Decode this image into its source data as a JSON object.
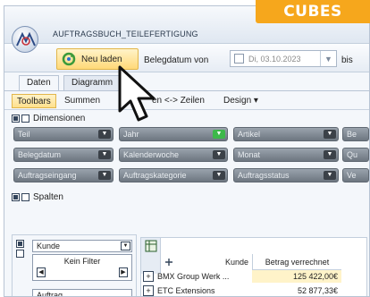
{
  "brand": {
    "label": "CUBES",
    "color": "#f6a71c"
  },
  "window": {
    "title": "AUFTRAGSBUCH_TEILEFERTIGUNG"
  },
  "toolbar": {
    "reload_label": "Neu laden",
    "date_label": "Belegdatum von",
    "date_value": "Di, 03.10.2023",
    "to_label": "bis"
  },
  "tabs": [
    "Daten",
    "Diagramm"
  ],
  "ribbon_tabs": [
    "Toolbars",
    "Summen",
    "Spalten <-> Zeilen",
    "Design ▾"
  ],
  "ribbon_tab_visible": [
    "Toolbars",
    "Summen",
    "en <-> Zeilen",
    "Design ▾"
  ],
  "sections": {
    "dimensions": "Dimensionen",
    "columns": "Spalten"
  },
  "dimensions": {
    "row1": [
      "Teil",
      "Jahr",
      "Artikel",
      "Be"
    ],
    "row2": [
      "Belegdatum",
      "Kalenderwoche",
      "Monat",
      "Qu"
    ],
    "row3": [
      "Auftragseingang",
      "Auftragskategorie",
      "Auftragsstatus",
      "Ve"
    ]
  },
  "row_panel": {
    "field": "Kunde",
    "filter_label": "Kein Filter",
    "field2": "Auftrag"
  },
  "grid": {
    "columns": [
      "Kunde",
      "Betrag verrechnet"
    ],
    "rows": [
      {
        "kunde": "BMX Group Werk ...",
        "betrag": "125 422,00€"
      },
      {
        "kunde": "ETC Extensions",
        "betrag": "52 877,33€"
      }
    ]
  }
}
